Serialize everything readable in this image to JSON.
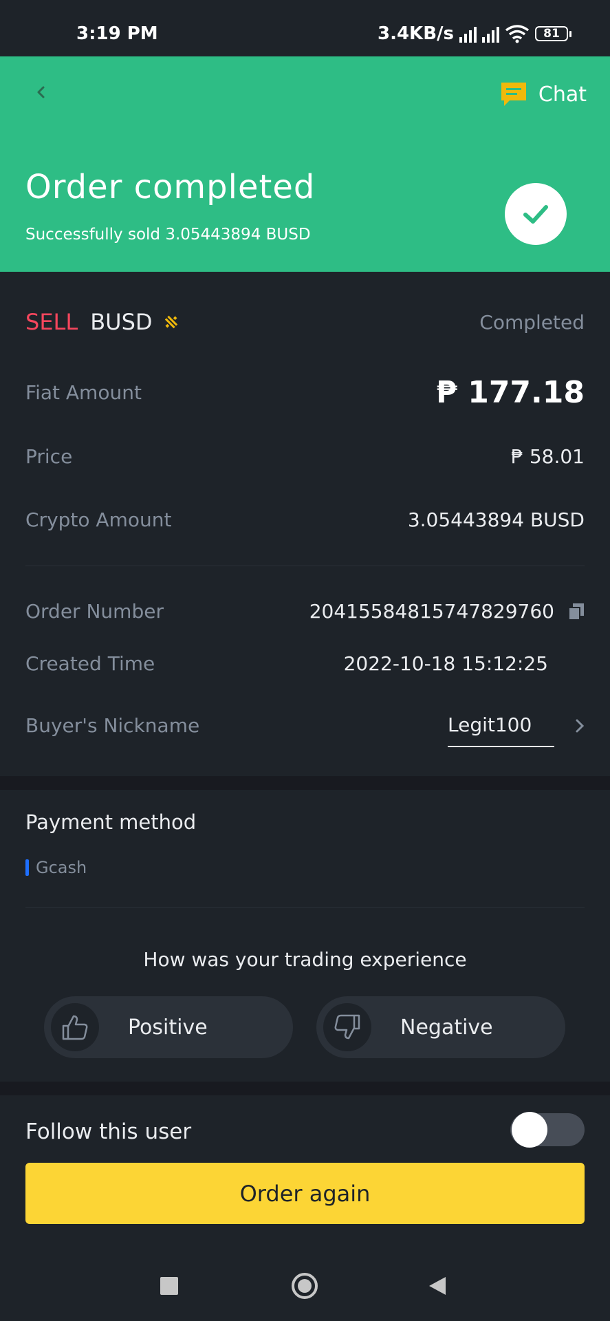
{
  "status_bar": {
    "time": "3:19 PM",
    "net_speed": "3.4KB/s",
    "battery": "81"
  },
  "header": {
    "chat_label": "Chat",
    "title": "Order completed",
    "subtitle": "Successfully sold  3.05443894 BUSD"
  },
  "order": {
    "side": "SELL",
    "asset": "BUSD",
    "status": "Completed",
    "fiat_amount_label": "Fiat Amount",
    "fiat_amount": "₱ 177.18",
    "price_label": "Price",
    "price": "₱ 58.01",
    "crypto_amount_label": "Crypto Amount",
    "crypto_amount": "3.05443894 BUSD",
    "order_number_label": "Order Number",
    "order_number": "20415584815747829760",
    "created_time_label": "Created Time",
    "created_time": "2022-10-18 15:12:25",
    "buyer_label": "Buyer's Nickname",
    "buyer": "Legit100"
  },
  "payment": {
    "title": "Payment method",
    "method": "Gcash"
  },
  "feedback": {
    "question": "How was your trading experience",
    "positive": "Positive",
    "negative": "Negative"
  },
  "follow": {
    "label": "Follow this user",
    "enabled": false
  },
  "cta": {
    "label": "Order again"
  },
  "colors": {
    "success": "#2ebd85",
    "sell": "#f6465d",
    "accent": "#fcd535",
    "background": "#1e2329"
  }
}
